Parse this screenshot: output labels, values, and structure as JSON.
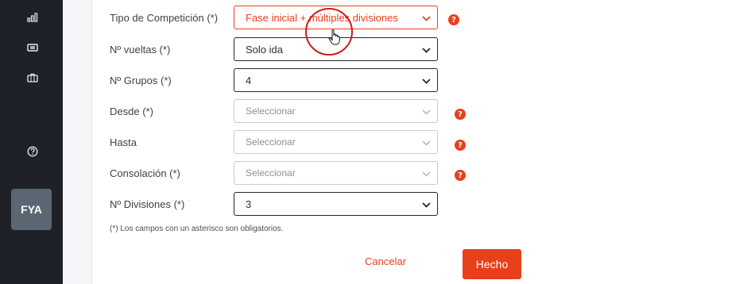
{
  "sidebar": {
    "icons": [
      "bar-chart-icon",
      "ticket-icon",
      "briefcase-icon",
      "help-circle-icon"
    ],
    "avatar": "FYA"
  },
  "form": {
    "fields": [
      {
        "label": "Tipo de Competición (*)",
        "value": "Fase inicial + múltiples divisiones",
        "state": "active",
        "help": true
      },
      {
        "label": "Nº vueltas (*)",
        "value": "Solo ida",
        "state": "normal",
        "help": false
      },
      {
        "label": "Nº Grupos (*)",
        "value": "4",
        "state": "normal",
        "help": false
      },
      {
        "label": "Desde (*)",
        "value": "Seleccionar",
        "state": "disabled",
        "help": true
      },
      {
        "label": "Hasta",
        "value": "Seleccionar",
        "state": "disabled",
        "help": true
      },
      {
        "label": "Consolación (*)",
        "value": "Seleccionar",
        "state": "disabled",
        "help": true
      },
      {
        "label": "Nº Divisiones (*)",
        "value": "3",
        "state": "normal",
        "help": false
      }
    ],
    "footnote": "(*) Los campos con un asterisco son obligatorios.",
    "cancel_label": "Cancelar",
    "done_label": "Hecho",
    "help_glyph": "?"
  },
  "colors": {
    "accent": "#e8401a",
    "sidebar_bg": "#1e2228",
    "avatar_bg": "#5a6773"
  }
}
